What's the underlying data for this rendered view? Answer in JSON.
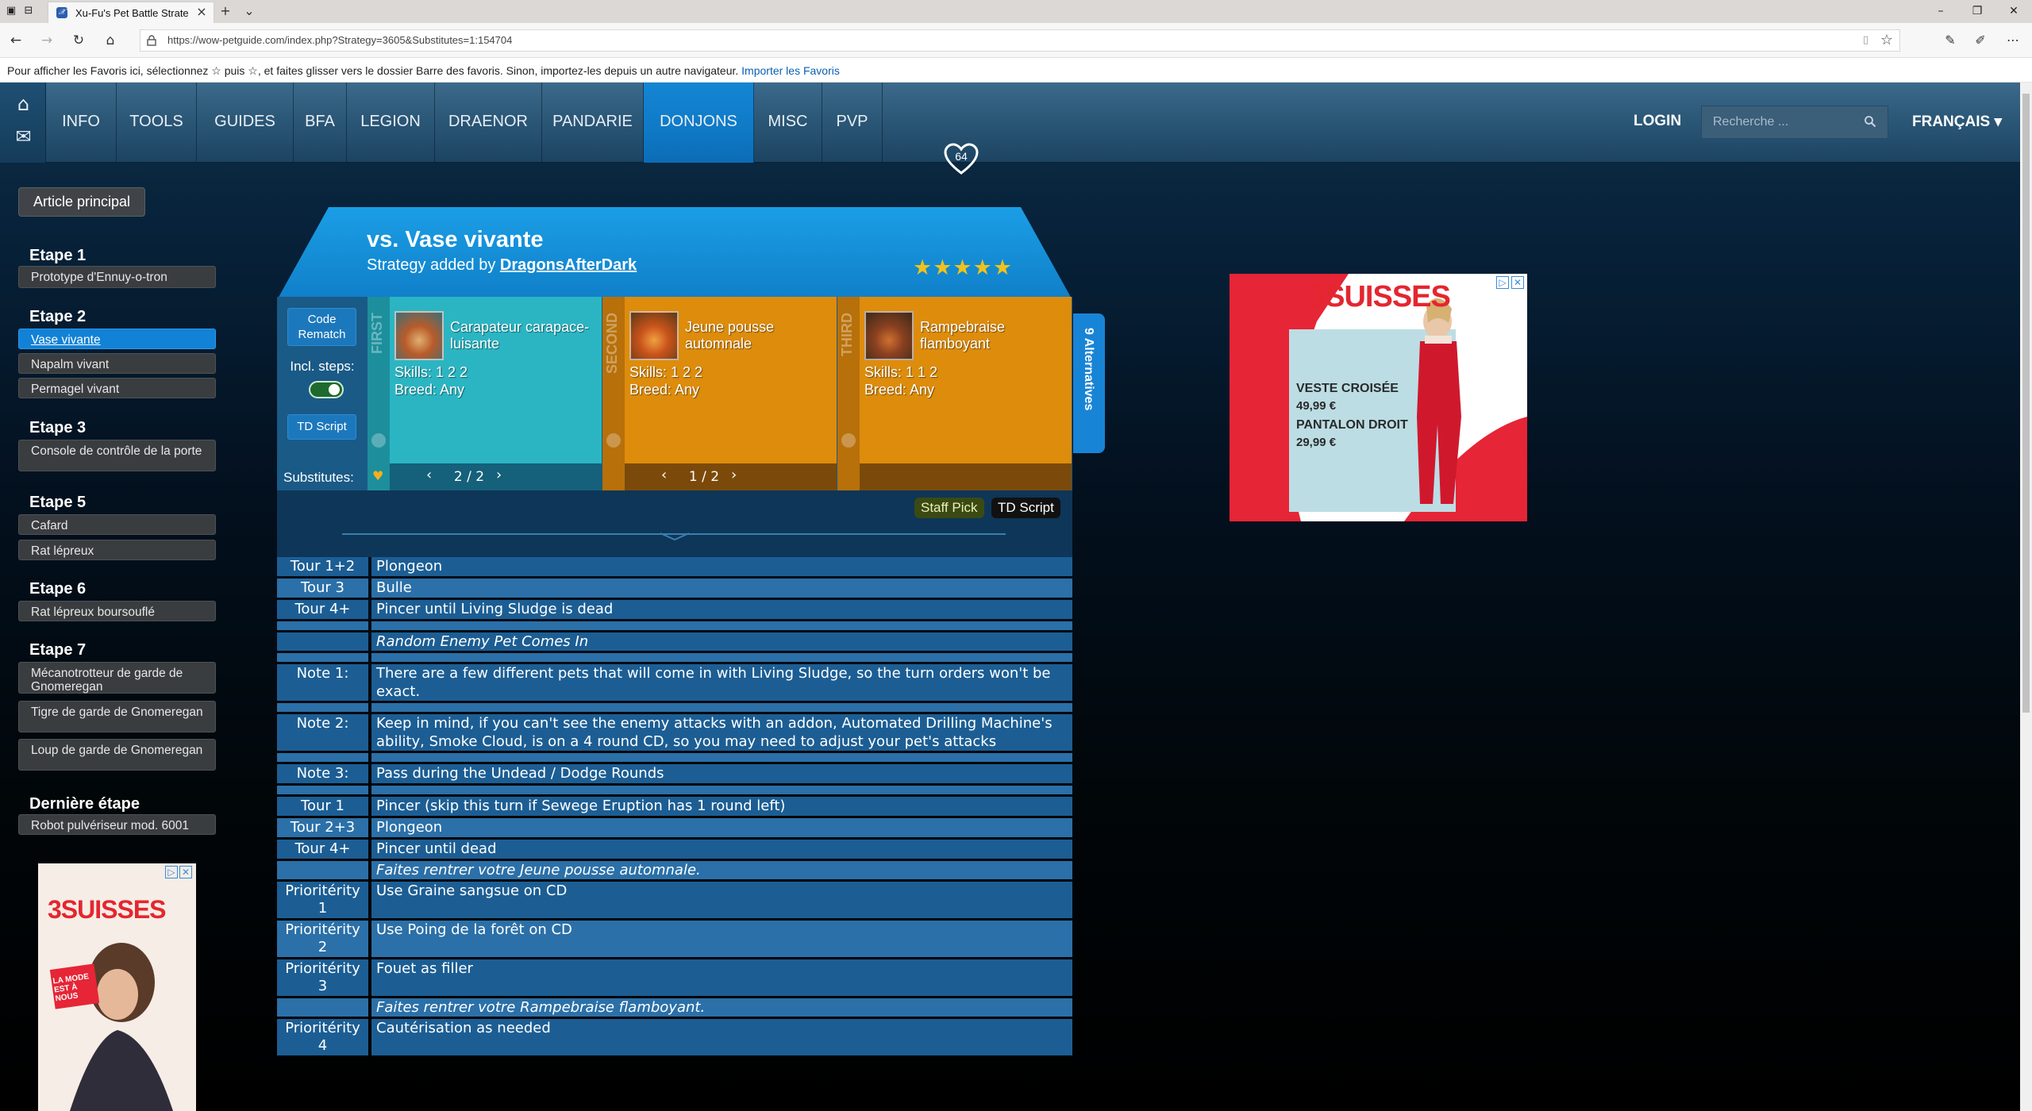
{
  "browser": {
    "tab_title": "Xu-Fu's Pet Battle Strate",
    "url": "https://wow-petguide.com/index.php?Strategy=3605&Substitutes=1:154704",
    "favorites_message": "Pour afficher les Favoris ici, sélectionnez ☆ puis ☆, et faites glisser vers le dossier Barre des favoris. Sinon, importez-les depuis un autre navigateur.",
    "favorites_link": "Importer les Favoris"
  },
  "header": {
    "menu": [
      "INFO",
      "TOOLS",
      "GUIDES",
      "BFA",
      "LEGION",
      "DRAENOR",
      "PANDARIE",
      "DONJONS",
      "MISC",
      "PVP"
    ],
    "active_menu": "DONJONS",
    "login": "LOGIN",
    "search_placeholder": "Recherche ...",
    "language": "FRANÇAIS ▾"
  },
  "sidebar": {
    "article_button": "Article principal",
    "steps": [
      {
        "title": "Etape 1",
        "links": [
          "Prototype d'Ennuy-o-tron"
        ]
      },
      {
        "title": "Etape 2",
        "links": [
          "Vase vivante",
          "Napalm vivant",
          "Permagel vivant"
        ]
      },
      {
        "title": "Etape 3",
        "links": [
          "Console de contrôle de la porte"
        ]
      },
      {
        "title": "Etape 5",
        "links": [
          "Cafard",
          "Rat lépreux"
        ]
      },
      {
        "title": "Etape 6",
        "links": [
          "Rat lépreux boursouflé"
        ]
      },
      {
        "title": "Etape 7",
        "links": [
          "Mécanotrotteur de garde de Gnomeregan",
          "Tigre de garde de Gnomeregan",
          "Loup de garde de Gnomeregan"
        ]
      },
      {
        "title": "Dernière étape",
        "links": [
          "Robot pulvériseur mod. 6001"
        ]
      }
    ],
    "active_link": "Vase vivante"
  },
  "strategy": {
    "title": "vs. Vase vivante",
    "added_by_prefix": "Strategy added by ",
    "author": "DragonsAfterDark",
    "likes": "64",
    "stars": "★★★★★",
    "rating_fraction": 1.0,
    "code_rematch": "Code Rematch",
    "incl_steps": "Incl. steps:",
    "td_script_button": "TD Script",
    "substitutes_label": "Substitutes:",
    "alternatives": "9 Alternatives",
    "tag_staff": "Staff Pick",
    "tag_td": "TD Script"
  },
  "pets": [
    {
      "slot": "FIRST",
      "name": "Carapateur carapace-luisante",
      "skills": "Skills: 1 2 2",
      "breed": "Breed: Any",
      "page": "2 / 2",
      "color": "#2bb5c3"
    },
    {
      "slot": "SECOND",
      "name": "Jeune pousse automnale",
      "skills": "Skills: 1 2 2",
      "breed": "Breed: Any",
      "page": "1 / 2",
      "color": "#dd8c0c"
    },
    {
      "slot": "THIRD",
      "name": "Rampebraise flamboyant",
      "skills": "Skills: 1 1 2",
      "breed": "Breed: Any",
      "page": "",
      "color": "#dd8c0c"
    }
  ],
  "steps_table": [
    {
      "k": "Tour 1+2",
      "v": "Plongeon",
      "s": "dark"
    },
    {
      "k": "Tour 3",
      "v": "Bulle",
      "s": "light"
    },
    {
      "k": "Tour 4+",
      "v": "Pincer until Living Sludge is dead",
      "s": "dark"
    },
    {
      "k": "",
      "v": "",
      "s": "spacer"
    },
    {
      "k": "",
      "v": "Random Enemy Pet Comes In",
      "s": "dark",
      "i": true
    },
    {
      "k": "",
      "v": "",
      "s": "spacer"
    },
    {
      "k": "Note 1:",
      "v": "There are a few different pets that will come in with Living Sludge, so the turn orders won't be exact.",
      "s": "dark"
    },
    {
      "k": "",
      "v": "",
      "s": "spacer"
    },
    {
      "k": "Note 2:",
      "v": "Keep in mind, if you can't see the enemy attacks with an addon, Automated Drilling Machine's ability, Smoke Cloud, is on a 4 round CD, so you may need to adjust your pet's attacks",
      "s": "dark"
    },
    {
      "k": "",
      "v": "",
      "s": "spacer"
    },
    {
      "k": "Note 3:",
      "v": "Pass during the Undead / Dodge Rounds",
      "s": "dark"
    },
    {
      "k": "",
      "v": "",
      "s": "spacer"
    },
    {
      "k": "Tour 1",
      "v": "Pincer (skip this turn if Sewege Eruption has 1 round left)",
      "s": "dark"
    },
    {
      "k": "Tour 2+3",
      "v": "Plongeon",
      "s": "light"
    },
    {
      "k": "Tour 4+",
      "v": "Pincer until dead",
      "s": "dark"
    },
    {
      "k": "",
      "v": "Faites rentrer votre Jeune pousse automnale.",
      "s": "light",
      "i": true
    },
    {
      "k": "Prioritérity 1",
      "v": "Use Graine sangsue on CD",
      "s": "dark"
    },
    {
      "k": "Prioritérity 2",
      "v": "Use Poing de la forêt on CD",
      "s": "light"
    },
    {
      "k": "Prioritérity 3",
      "v": "Fouet as filler",
      "s": "dark"
    },
    {
      "k": "",
      "v": "Faites rentrer votre Rampebraise flamboyant.",
      "s": "light",
      "i": true
    },
    {
      "k": "Prioritérity 4",
      "v": "Cautérisation as needed",
      "s": "dark"
    }
  ],
  "ads": {
    "brand": "3SUISSES",
    "right_line1": "VESTE CROISÉE",
    "right_price1": "49,99 €",
    "right_line2": "PANTALON DROIT",
    "right_price2": "29,99 €",
    "left_text": "LA MODE EST À NOUS"
  }
}
